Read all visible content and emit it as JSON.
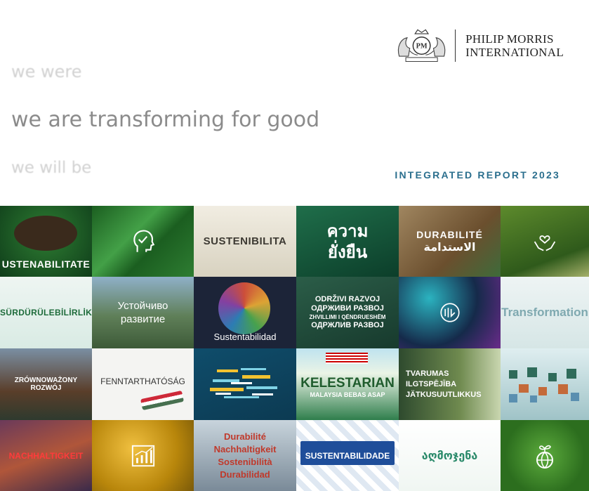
{
  "brand": {
    "line1": "PHILIP MORRIS",
    "line2": "INTERNATIONAL",
    "crest_icon": "pmi-crest-icon"
  },
  "tagline": {
    "line1": "we were",
    "line2": "we are transforming for good",
    "line3": "we will be"
  },
  "report_title": "INTEGRATED REPORT 2023",
  "tiles": {
    "r1c1": "USTENABILITATE",
    "r1c3": "SUSTENIBILITA",
    "r1c4": [
      "ความ",
      "ยั่งยืน"
    ],
    "r1c5": [
      "DURABILITÉ",
      "الاستدامة"
    ],
    "r2c1": "SÜRDÜRÜLEBİLİRLİK",
    "r2c2": [
      "Устойчиво",
      "развитие"
    ],
    "r2c3": "Sustentabilidad",
    "r2c4": [
      "ODRŽIVI RAZVOJ",
      "ОДРЖИВИ РАЗВОЈ",
      "ZHVILLIMI I QËNDRUESHËM",
      "ОДРЖЛИВ РАЗВОЈ"
    ],
    "r2c6": "Transformation",
    "r3c1": "ZRÓWNOWAŻONY ROZWÓJ",
    "r3c2": "FENNTARTHATÓSÁG",
    "r3c4": [
      "KELESTARIAN",
      "MALAYSIA BEBAS ASAP"
    ],
    "r3c5": [
      "TVARUMAS",
      "ILGTSPĒJĪBA",
      "JÄTKUSUUTLIKKUS"
    ],
    "r4c1": "NACHHALTIGKEIT",
    "r4c3": [
      "Durabilité",
      "Nachhaltigkeit",
      "Sostenibilità",
      "Durabilidad"
    ],
    "r4c4": "SUSTENTABILIDADE",
    "r4c5": "აღმოჯენა"
  },
  "colors": {
    "title_teal": "#2b6f8e",
    "tagline_gray": "#9a9a9a"
  }
}
